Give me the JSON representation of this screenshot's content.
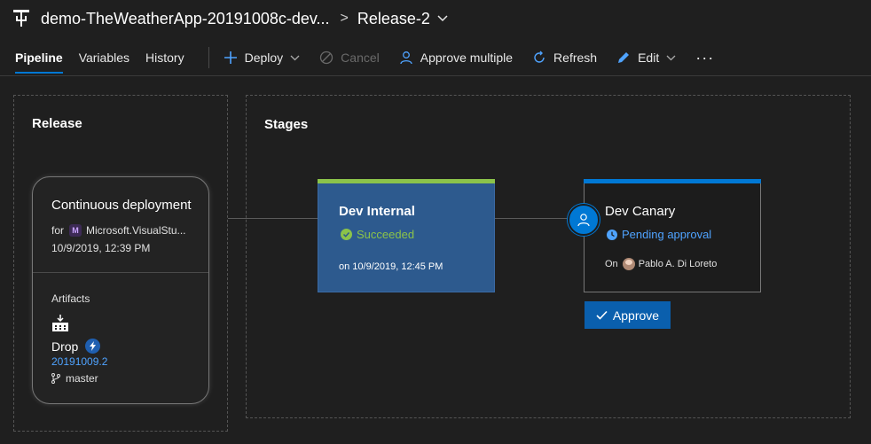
{
  "header": {
    "pipeline_name": "demo-TheWeatherApp-20191008c-dev...",
    "separator": ">",
    "release_name": "Release-2"
  },
  "tabs": [
    {
      "label": "Pipeline",
      "active": true
    },
    {
      "label": "Variables",
      "active": false
    },
    {
      "label": "History",
      "active": false
    }
  ],
  "toolbar": {
    "deploy_label": "Deploy",
    "cancel_label": "Cancel",
    "approve_multiple_label": "Approve multiple",
    "refresh_label": "Refresh",
    "edit_label": "Edit",
    "more_label": "···"
  },
  "release_panel": {
    "title": "Release",
    "card": {
      "trigger": "Continuous deployment",
      "for_prefix": "for",
      "requested_for_badge": "M",
      "requested_for": "Microsoft.VisualStu...",
      "date": "10/9/2019, 12:39 PM",
      "artifacts_label": "Artifacts",
      "artifact_name": "Drop",
      "build_number": "20191009.2",
      "branch": "master"
    }
  },
  "stages_panel": {
    "title": "Stages",
    "stages": [
      {
        "name": "Dev Internal",
        "status": "Succeeded",
        "date": "on 10/9/2019, 12:45 PM",
        "color": "#8bc34a"
      },
      {
        "name": "Dev Canary",
        "status": "Pending approval",
        "on_prefix": "On",
        "approver": "Pablo A. Di Loreto",
        "color": "#0078d4"
      }
    ],
    "approve_button": "Approve"
  },
  "colors": {
    "accent": "#0078d4",
    "success": "#8bc34a",
    "link": "#4fa3ff",
    "background": "#1f1f1f"
  }
}
